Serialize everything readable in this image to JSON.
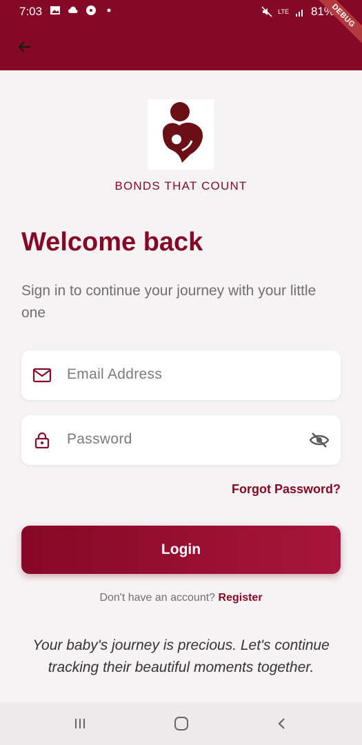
{
  "status_bar": {
    "time": "7:03",
    "battery": "81%",
    "network": "LTE",
    "debug_label": "DEBUG"
  },
  "brand": {
    "name": "BONDS THAT COUNT",
    "color": "#850826"
  },
  "header": {
    "title": "Welcome back",
    "subtitle": "Sign in to continue your journey with your little one"
  },
  "form": {
    "email_placeholder": "Email Address",
    "password_placeholder": "Password",
    "forgot_label": "Forgot Password?",
    "login_label": "Login"
  },
  "register": {
    "prompt": "Don't have an account?",
    "link": "Register"
  },
  "quote": "Your baby's journey is precious. Let's continue tracking their beautiful moments together.",
  "icons": {
    "back": "arrow-left-icon",
    "email": "mail-icon",
    "password": "lock-icon",
    "visibility": "eye-off-icon"
  },
  "colors": {
    "primary": "#850826",
    "gradient_end": "#a8153b",
    "background": "#f5f3f4"
  }
}
